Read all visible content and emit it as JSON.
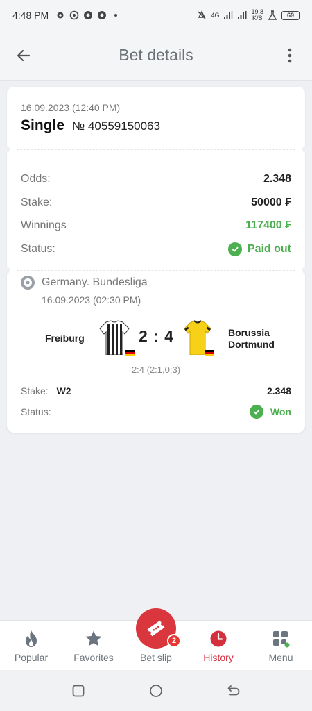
{
  "status_bar": {
    "time": "4:48 PM",
    "net_speed_value": "19.8",
    "net_speed_unit": "K/S",
    "network": "4G",
    "battery": "69",
    "icons": [
      "gear-icon",
      "whatsapp-icon",
      "whatsapp-icon",
      "whatsapp-icon",
      "dot-icon",
      "mute-icon",
      "signal-icon",
      "signal-icon",
      "lab-icon",
      "battery-icon"
    ]
  },
  "app_bar": {
    "title": "Bet details",
    "back_icon": "arrow-left-icon",
    "menu_icon": "more-vertical-icon"
  },
  "bet": {
    "date": "16.09.2023 (12:40 PM)",
    "type": "Single",
    "number": "№ 40559150063",
    "odds_label": "Odds:",
    "odds_value": "2.348",
    "stake_label": "Stake:",
    "stake_value": "50000 ₣",
    "winnings_label": "Winnings",
    "winnings_value": "117400 ₣",
    "status_label": "Status:",
    "status_value": "Paid out"
  },
  "event": {
    "league": "Germany. Bundesliga",
    "date": "16.09.2023 (02:30 PM)",
    "home_team": "Freiburg",
    "away_team_line1": "Borussia",
    "away_team_line2": "Dortmund",
    "score": "2 : 4",
    "score_detail": "2:4 (2:1,0:3)",
    "stake_label": "Stake:",
    "pick": "W2",
    "odds": "2.348",
    "status_label": "Status:",
    "status_value": "Won"
  },
  "bottom_nav": {
    "items": [
      {
        "label": "Popular",
        "icon": "flame-icon"
      },
      {
        "label": "Favorites",
        "icon": "star-icon"
      },
      {
        "label": "Bet slip",
        "icon": "ticket-icon"
      },
      {
        "label": "History",
        "icon": "clock-icon"
      },
      {
        "label": "Menu",
        "icon": "grid-icon"
      }
    ],
    "active": "History",
    "bet_slip_badge": "2"
  },
  "colors": {
    "accent_red": "#d9363e",
    "success_green": "#4caf50",
    "muted_text": "#777777",
    "background": "#eef0f3"
  }
}
